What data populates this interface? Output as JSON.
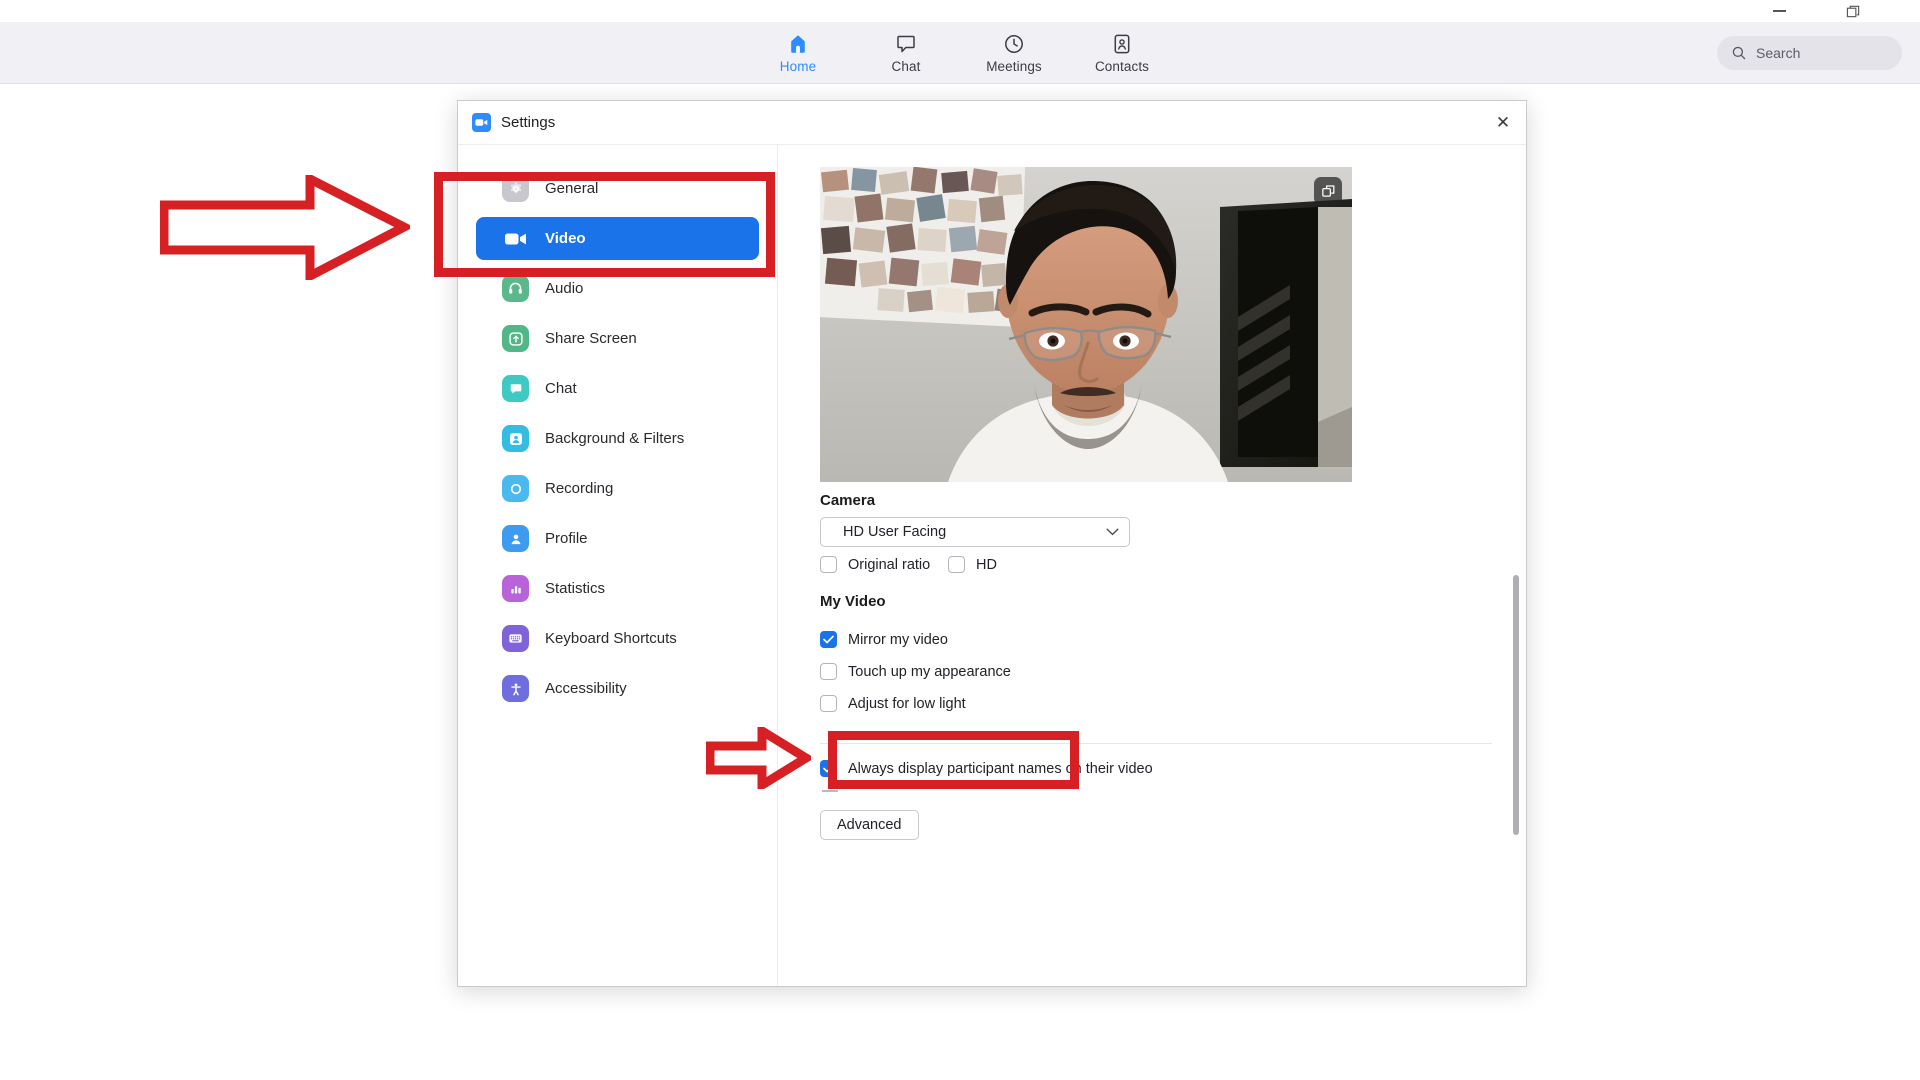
{
  "window_controls": {
    "minimize": "minimize",
    "restore": "restore"
  },
  "app_header": {
    "tabs": [
      {
        "label": "Home",
        "icon": "home-icon",
        "active": true
      },
      {
        "label": "Chat",
        "icon": "chat-icon",
        "active": false
      },
      {
        "label": "Meetings",
        "icon": "clock-icon",
        "active": false
      },
      {
        "label": "Contacts",
        "icon": "contacts-icon",
        "active": false
      }
    ],
    "search": {
      "placeholder": "Search",
      "icon": "search-icon"
    },
    "accent_color": "#2d8cff",
    "background_color": "#f1f0f5"
  },
  "settings_dialog": {
    "title": "Settings",
    "logo_icon": "zoom-video-logo-icon",
    "close_icon": "close-icon",
    "sidebar": {
      "items": [
        {
          "label": "General",
          "icon": "gear-icon",
          "color": "#c7c7cc",
          "selected": false
        },
        {
          "label": "Video",
          "icon": "video-camera-icon",
          "color": "#1a73e8",
          "selected": true
        },
        {
          "label": "Audio",
          "icon": "headphones-icon",
          "color": "#5ab88a",
          "selected": false
        },
        {
          "label": "Share Screen",
          "icon": "share-screen-icon",
          "color": "#52b788",
          "selected": false
        },
        {
          "label": "Chat",
          "icon": "chat-bubble-icon",
          "color": "#3ec9c4",
          "selected": false
        },
        {
          "label": "Background & Filters",
          "icon": "person-frame-icon",
          "color": "#34bde0",
          "selected": false
        },
        {
          "label": "Recording",
          "icon": "record-circle-icon",
          "color": "#49b9ef",
          "selected": false
        },
        {
          "label": "Profile",
          "icon": "person-icon",
          "color": "#3d9bf0",
          "selected": false
        },
        {
          "label": "Statistics",
          "icon": "bar-chart-icon",
          "color": "#b863d9",
          "selected": false
        },
        {
          "label": "Keyboard Shortcuts",
          "icon": "keyboard-icon",
          "color": "#8163d9",
          "selected": false
        },
        {
          "label": "Accessibility",
          "icon": "accessibility-icon",
          "color": "#6f6ee0",
          "selected": false
        }
      ]
    },
    "main": {
      "preview": {
        "popout_icon": "popout-window-icon"
      },
      "camera": {
        "heading": "Camera",
        "selected_device": "HD User Facing",
        "dropdown_icon": "chevron-down-icon",
        "options": [
          {
            "label": "Original ratio",
            "checked": false
          },
          {
            "label": "HD",
            "checked": false
          }
        ]
      },
      "my_video": {
        "heading": "My Video",
        "options": [
          {
            "label": "Mirror my video",
            "checked": true
          },
          {
            "label": "Touch up my appearance",
            "checked": false
          },
          {
            "label": "Adjust for low light",
            "checked": false
          }
        ]
      },
      "participant_names": {
        "label": "Always display participant names on their video",
        "checked": true
      },
      "advanced_button": "Advanced"
    }
  },
  "annotations": {
    "color": "#d62023",
    "shapes": [
      {
        "type": "arrow-right",
        "target": "sidebar-item-video"
      },
      {
        "type": "rectangle",
        "target": "sidebar-item-video"
      },
      {
        "type": "arrow-right",
        "target": "touch-up-my-appearance-checkbox"
      },
      {
        "type": "rectangle",
        "target": "touch-up-my-appearance-checkbox"
      }
    ]
  }
}
